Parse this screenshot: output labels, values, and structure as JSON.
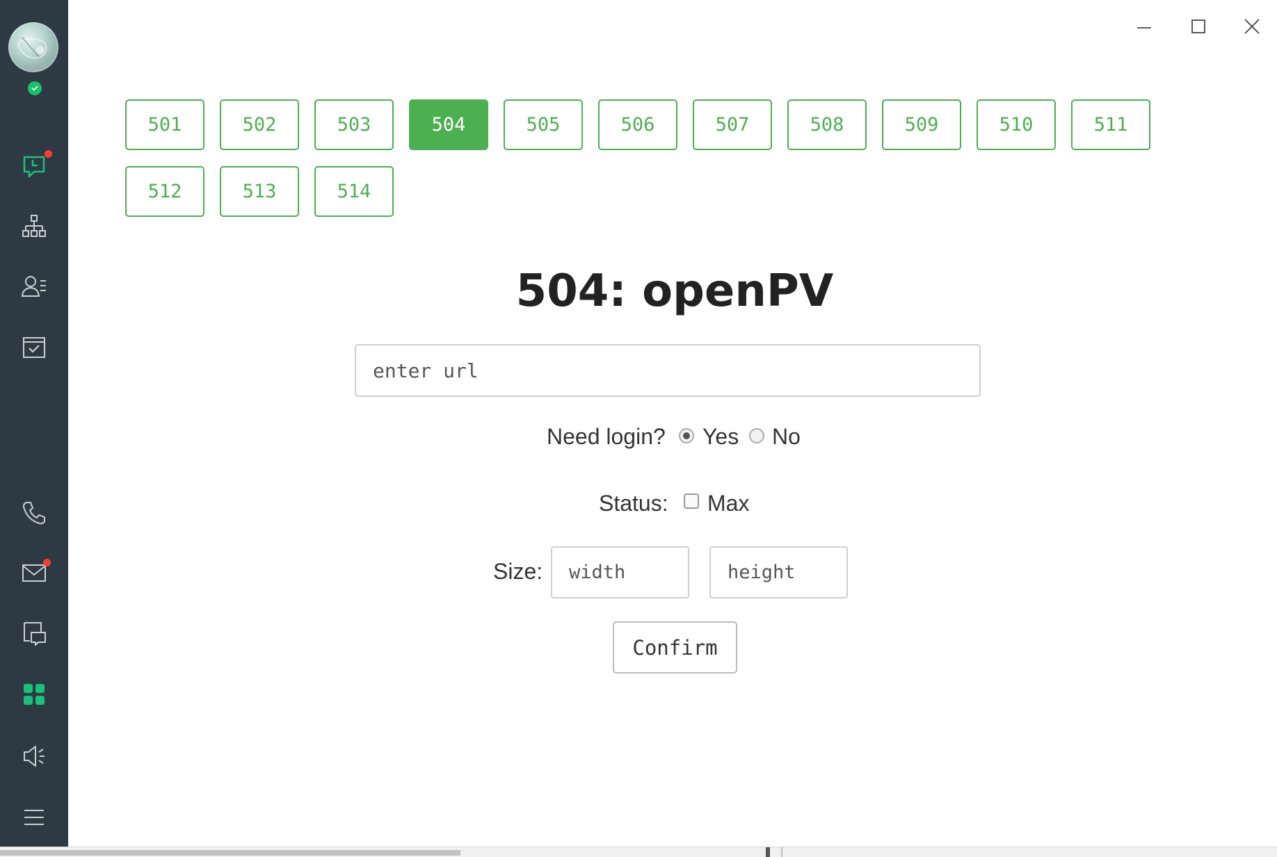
{
  "sidebar": {
    "avatar": "user-avatar",
    "status": "online",
    "items": [
      {
        "name": "chat",
        "icon": "chat-icon",
        "badge": true,
        "active": true
      },
      {
        "name": "organization",
        "icon": "org-chart-icon",
        "badge": false
      },
      {
        "name": "contacts",
        "icon": "contacts-icon",
        "badge": false
      },
      {
        "name": "tasks",
        "icon": "calendar-check-icon",
        "badge": false
      },
      {
        "name": "calls",
        "icon": "phone-icon",
        "badge": false
      },
      {
        "name": "mail",
        "icon": "mail-icon",
        "badge": true
      },
      {
        "name": "meeting",
        "icon": "screen-share-icon",
        "badge": false
      },
      {
        "name": "apps",
        "icon": "apps-grid-icon",
        "badge": false,
        "accent": true
      },
      {
        "name": "announcements",
        "icon": "speaker-icon",
        "badge": false
      },
      {
        "name": "menu",
        "icon": "hamburger-menu-icon",
        "badge": false
      }
    ]
  },
  "colors": {
    "sidebar_bg": "#2e3a43",
    "accent_green": "#4caf50",
    "sidebar_accent": "#19c27a",
    "badge_red": "#ff3b30"
  },
  "rooms": {
    "items": [
      "501",
      "502",
      "503",
      "504",
      "505",
      "506",
      "507",
      "508",
      "509",
      "510",
      "511",
      "512",
      "513",
      "514"
    ],
    "selected": "504"
  },
  "form": {
    "title": "504: openPV",
    "url_placeholder": "enter url",
    "url_value": "",
    "login_label": "Need login?",
    "login_yes": "Yes",
    "login_no": "No",
    "login_selected": "Yes",
    "status_label": "Status:",
    "status_max": "Max",
    "status_max_checked": false,
    "size_label": "Size:",
    "width_placeholder": "width",
    "height_placeholder": "height",
    "confirm_label": "Confirm"
  }
}
